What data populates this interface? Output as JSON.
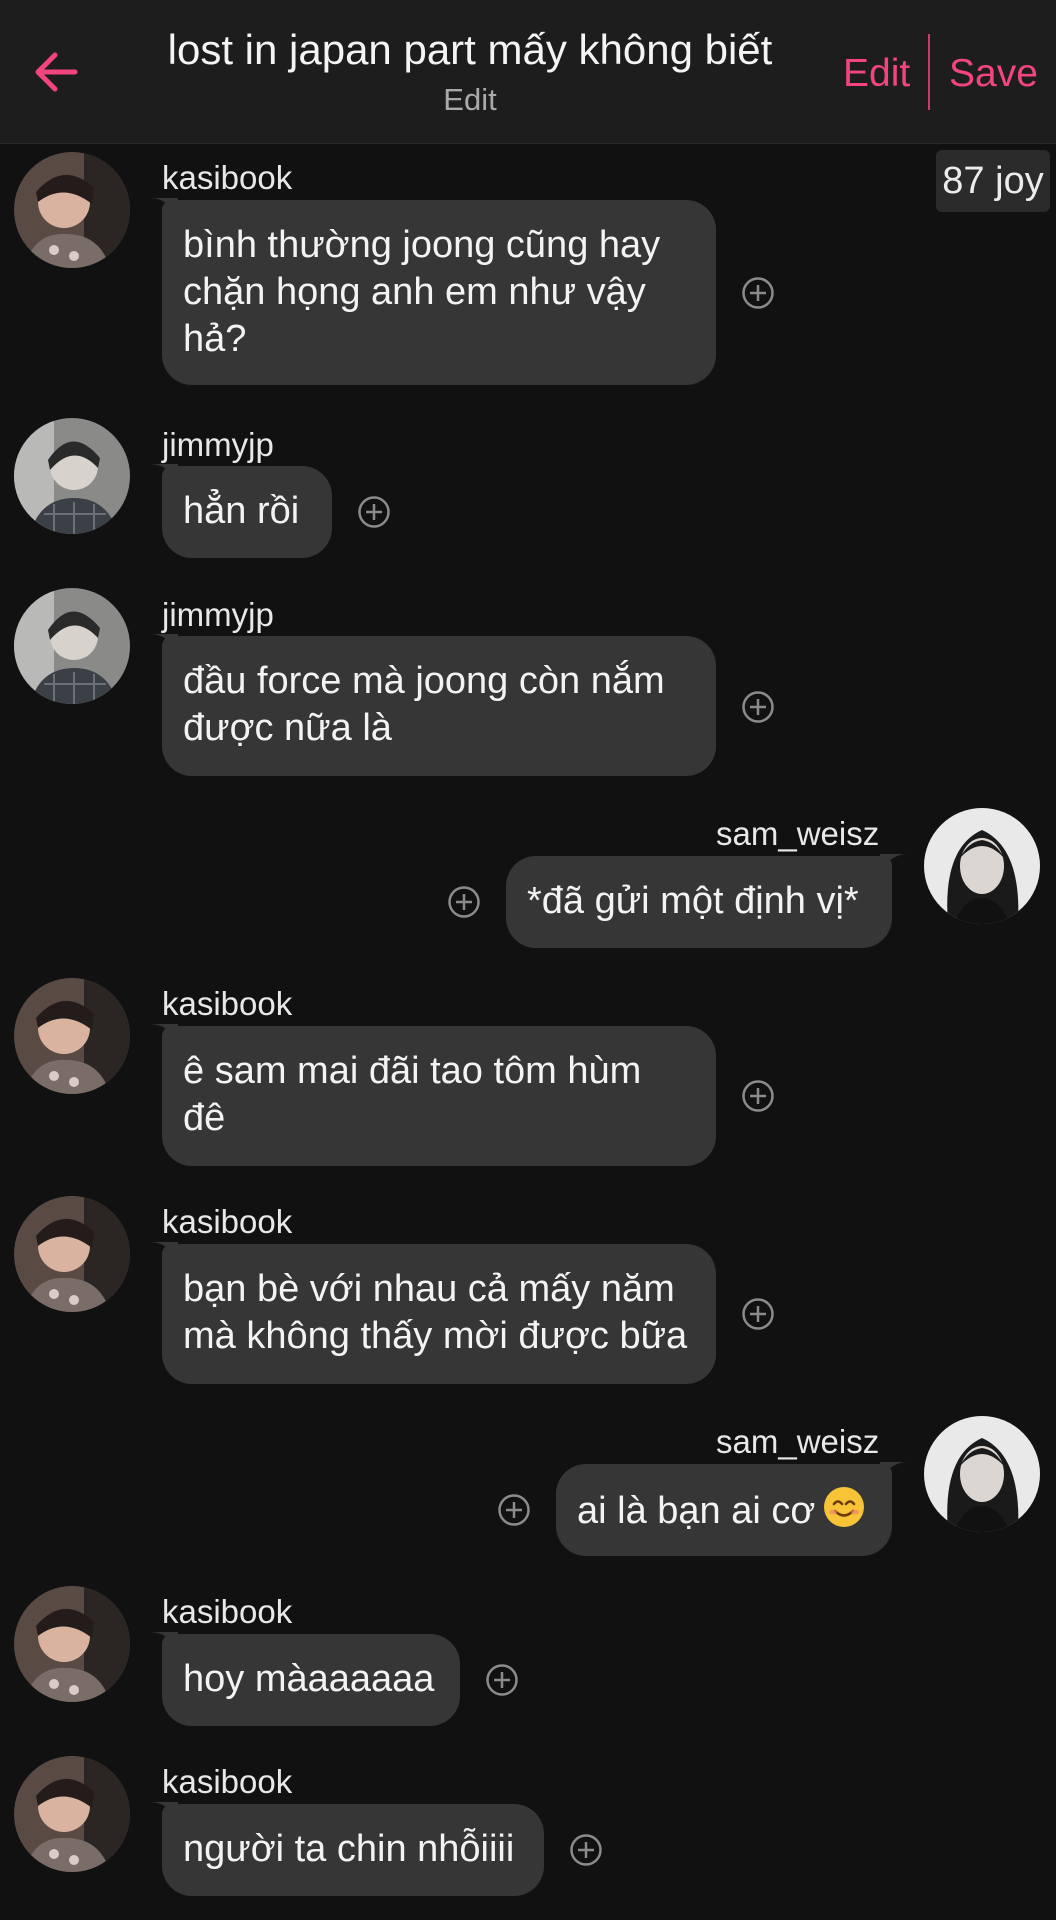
{
  "header": {
    "title": "lost in japan part mấy không biết",
    "subtitle": "Edit",
    "edit_label": "Edit",
    "save_label": "Save",
    "accent_color": "#f2457f"
  },
  "counter": "87 joy",
  "messages": [
    {
      "user": "kasibook",
      "side": "left",
      "text": "bình thường joong cũng hay chặn họng anh em như vậy hả?"
    },
    {
      "user": "jimmyjp",
      "side": "left",
      "text": "hẳn rồi"
    },
    {
      "user": "jimmyjp",
      "side": "left",
      "text": "đầu force mà joong còn nắm được nữa là"
    },
    {
      "user": "sam_weisz",
      "side": "right",
      "text": "*đã gửi một định vị*"
    },
    {
      "user": "kasibook",
      "side": "left",
      "text": "ê sam mai đãi tao tôm hùm đê"
    },
    {
      "user": "kasibook",
      "side": "left",
      "text": "bạn bè với nhau cả mấy năm mà không thấy mời được bữa"
    },
    {
      "user": "sam_weisz",
      "side": "right",
      "text": "ai là bạn ai cơ",
      "emoji": "smiling-face-emoji"
    },
    {
      "user": "kasibook",
      "side": "left",
      "text": "hoy màaaaaaa"
    },
    {
      "user": "kasibook",
      "side": "left",
      "text": "người ta chin nhỗiiii"
    }
  ],
  "icons": {
    "back": "arrow-left-icon",
    "react": "add-reaction-icon"
  }
}
